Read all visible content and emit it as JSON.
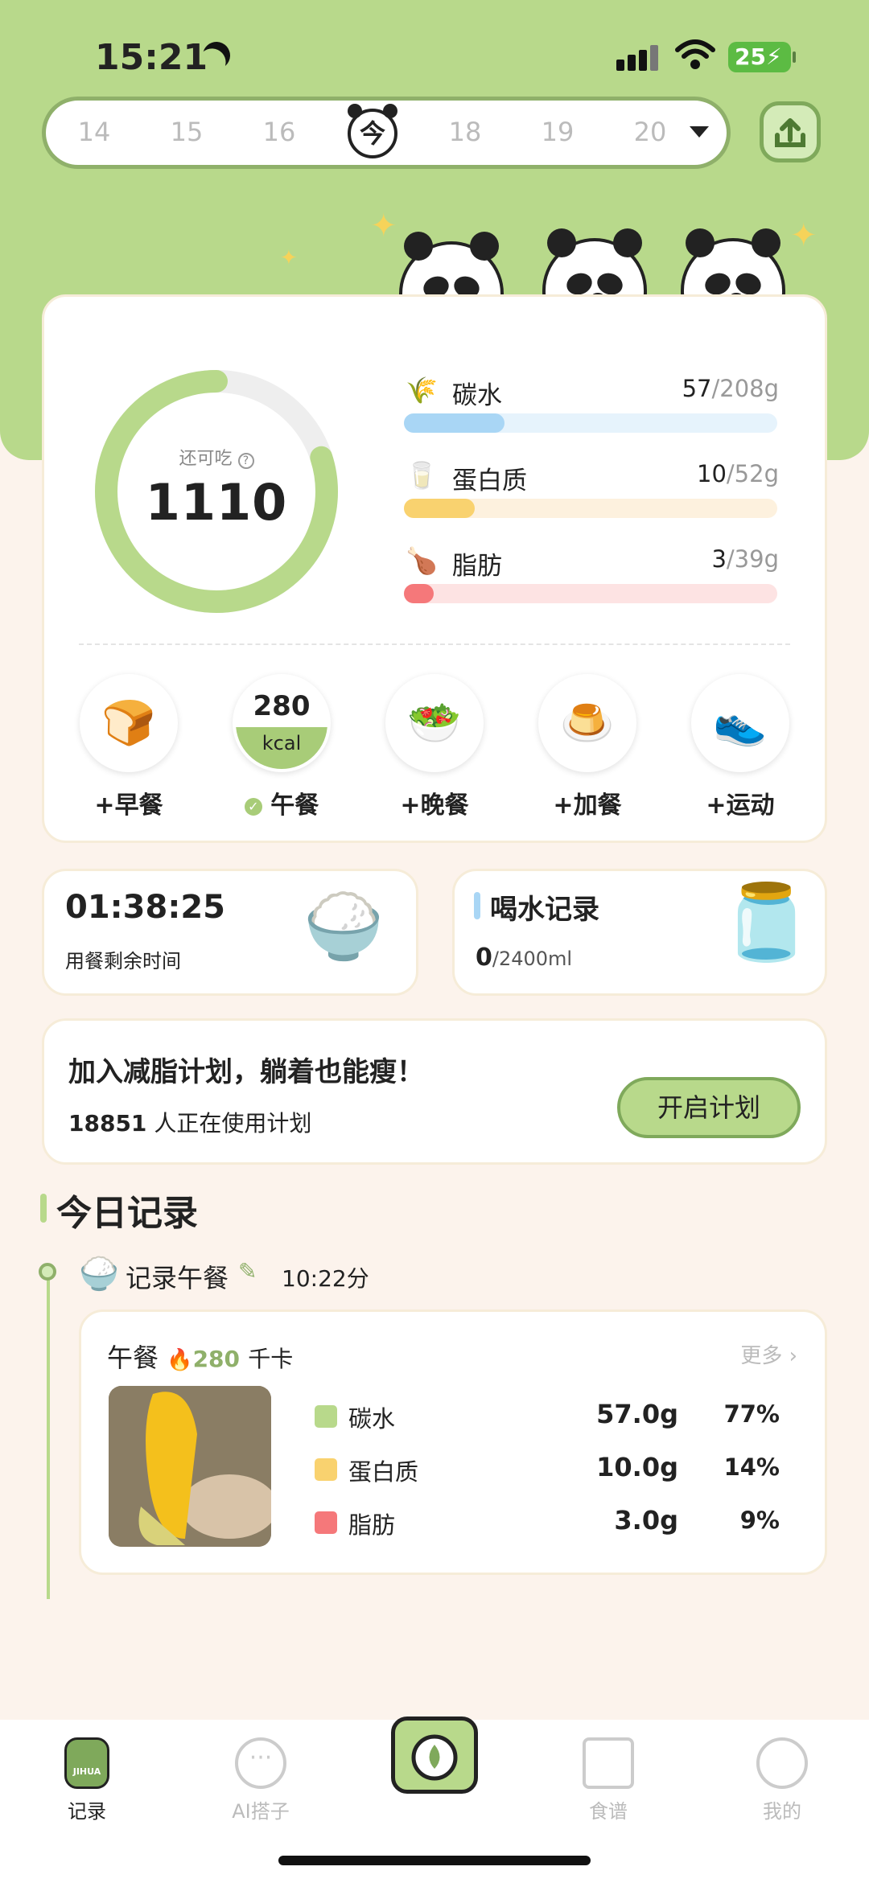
{
  "status": {
    "time": "15:21",
    "battery": "25"
  },
  "date_bar": {
    "days": [
      "14",
      "15",
      "16",
      "今",
      "18",
      "19",
      "20"
    ]
  },
  "summary": {
    "ring_label": "还可吃",
    "ring_value": "1110",
    "ring_fraction": 0.2,
    "macros": [
      {
        "name": "碳水",
        "value": "57",
        "total": "/208g",
        "fraction": 0.27,
        "color": "#a9d6f5",
        "track": "#e6f3fc",
        "icon": "wheat-icon"
      },
      {
        "name": "蛋白质",
        "value": "10",
        "total": "/52g",
        "fraction": 0.19,
        "color": "#f9d26f",
        "track": "#fdf1de",
        "icon": "milk-carton-icon"
      },
      {
        "name": "脂肪",
        "value": "3",
        "total": "/39g",
        "fraction": 0.08,
        "color": "#f5787a",
        "track": "#fde3e3",
        "icon": "drumstick-icon"
      }
    ]
  },
  "meals": [
    {
      "label": "早餐",
      "prefix": "+",
      "icon": "bread-icon"
    },
    {
      "label": "午餐",
      "kcal": "280",
      "unit": "kcal",
      "icon": "check-icon"
    },
    {
      "label": "晚餐",
      "prefix": "+",
      "icon": "salad-bowl-icon"
    },
    {
      "label": "加餐",
      "prefix": "+",
      "icon": "pudding-icon"
    },
    {
      "label": "运动",
      "prefix": "+",
      "icon": "sneaker-icon"
    }
  ],
  "timer": {
    "value": "01:38:25",
    "label": "用餐剩余时间"
  },
  "water": {
    "title": "喝水记录",
    "value": "0",
    "total": "/2400ml"
  },
  "plan": {
    "title": "加入减脂计划，躺着也能瘦！",
    "count": "18851",
    "count_suffix": "人正在使用计划",
    "button": "开启计划"
  },
  "today": {
    "section_title": "今日记录",
    "entry_title": "记录午餐",
    "entry_time": "10:22分",
    "card": {
      "meal": "午餐",
      "kcal": "280",
      "kcal_unit": "千卡",
      "more": "更多",
      "rows": [
        {
          "name": "碳水",
          "grams": "57.0g",
          "pct": "77%",
          "color": "#b8d98b"
        },
        {
          "name": "蛋白质",
          "grams": "10.0g",
          "pct": "14%",
          "color": "#f9d26f"
        },
        {
          "name": "脂肪",
          "grams": "3.0g",
          "pct": "9%",
          "color": "#f5787a"
        }
      ]
    }
  },
  "tabs": [
    {
      "label": "记录",
      "icon": "journal-icon",
      "active": true,
      "badge": "JIHUA"
    },
    {
      "label": "AI搭子",
      "icon": "chat-bubble-icon"
    },
    {
      "label": "",
      "icon": "camera-icon"
    },
    {
      "label": "食谱",
      "icon": "recipe-book-icon"
    },
    {
      "label": "我的",
      "icon": "panda-profile-icon"
    }
  ]
}
